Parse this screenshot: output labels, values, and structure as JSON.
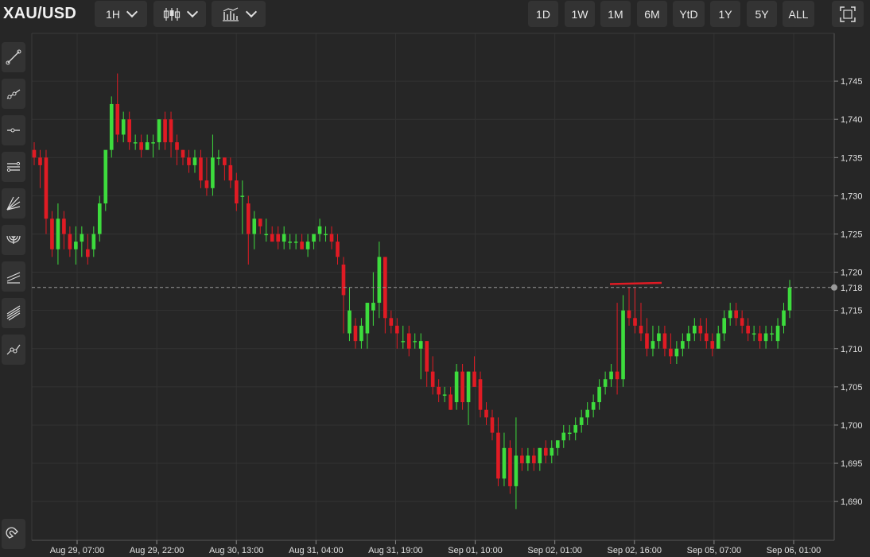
{
  "header": {
    "symbol": "XAU/USD",
    "interval": "1H",
    "chart_style_icon": "candlestick-icon",
    "indicators_icon": "indicators-icon",
    "ranges": [
      "1D",
      "1W",
      "1M",
      "6M",
      "YtD",
      "1Y",
      "5Y",
      "ALL"
    ],
    "fullscreen_icon": "fullscreen-icon"
  },
  "sidebar": {
    "tools": [
      "trend-line-icon",
      "ray-icon",
      "horizontal-ray-icon",
      "parallel-channel-icon",
      "fan-icon",
      "arc-icon",
      "regression-icon",
      "pitchfork-icon",
      "polyline-icon"
    ],
    "magnet_icon": "magnet-icon"
  },
  "colors": {
    "background": "#262626",
    "up": "#3ddc3d",
    "down": "#e01b24",
    "grid": "#333333",
    "button": "#333333"
  },
  "chart_data": {
    "type": "candlestick",
    "title": "",
    "ylim": [
      1687,
      1750
    ],
    "y_ticks": [
      "1,690",
      "1,695",
      "1,700",
      "1,705",
      "1,710",
      "1,715",
      "1,718",
      "1,720",
      "1,725",
      "1,730",
      "1,735",
      "1,740",
      "1,745"
    ],
    "last_price": "1,718",
    "x_ticks": [
      "Aug 29, 07:00",
      "Aug 29, 22:00",
      "Aug 30, 13:00",
      "Aug 31, 04:00",
      "Aug 31, 19:00",
      "Sep 01, 10:00",
      "Sep 02, 01:00",
      "Sep 02, 16:00",
      "Sep 05, 07:00",
      "Sep 06, 01:00"
    ],
    "grid": true,
    "annotations": [
      {
        "type": "horizontal-line",
        "price": 1718.5,
        "color": "#e01b24"
      }
    ],
    "ohlc": [
      [
        1736,
        1737,
        1734,
        1735
      ],
      [
        1735,
        1736,
        1731,
        1734
      ],
      [
        1735,
        1736,
        1725,
        1727
      ],
      [
        1727,
        1728,
        1722,
        1723
      ],
      [
        1723,
        1729,
        1721,
        1727
      ],
      [
        1727,
        1728,
        1723,
        1725
      ],
      [
        1725,
        1726,
        1722,
        1723
      ],
      [
        1723,
        1726,
        1721,
        1724
      ],
      [
        1724,
        1726,
        1722,
        1725
      ],
      [
        1723,
        1725,
        1721,
        1722
      ],
      [
        1723,
        1726,
        1722,
        1725
      ],
      [
        1725,
        1730,
        1724,
        1729
      ],
      [
        1729,
        1734,
        1728,
        1736
      ],
      [
        1736,
        1743,
        1735,
        1742
      ],
      [
        1742,
        1746,
        1737,
        1738
      ],
      [
        1738,
        1741,
        1737,
        1740
      ],
      [
        1740,
        1741,
        1736,
        1737
      ],
      [
        1737,
        1738,
        1736,
        1737
      ],
      [
        1737,
        1738,
        1735,
        1736
      ],
      [
        1736,
        1738,
        1736,
        1737
      ],
      [
        1737,
        1738,
        1735,
        1737
      ],
      [
        1737,
        1740,
        1736,
        1740
      ],
      [
        1740,
        1741,
        1736,
        1737
      ],
      [
        1740,
        1741,
        1735,
        1737
      ],
      [
        1737,
        1738,
        1734,
        1736
      ],
      [
        1736,
        1736,
        1734,
        1735
      ],
      [
        1735,
        1736,
        1733,
        1734
      ],
      [
        1734,
        1736,
        1733,
        1735
      ],
      [
        1735,
        1736,
        1731,
        1732
      ],
      [
        1732,
        1735,
        1730,
        1731
      ],
      [
        1731,
        1738,
        1730,
        1735
      ],
      [
        1735,
        1736,
        1734,
        1735
      ],
      [
        1735,
        1735,
        1732,
        1734
      ],
      [
        1734,
        1735,
        1731,
        1732
      ],
      [
        1732,
        1733,
        1728,
        1729
      ],
      [
        1730,
        1732,
        1725,
        1730
      ],
      [
        1729,
        1730,
        1721,
        1725
      ],
      [
        1725,
        1728,
        1723,
        1727
      ],
      [
        1727,
        1727,
        1725,
        1726
      ],
      [
        1725,
        1727,
        1724,
        1725
      ],
      [
        1725,
        1726,
        1724,
        1724
      ],
      [
        1725,
        1726,
        1723,
        1724
      ],
      [
        1724,
        1726,
        1723,
        1725
      ],
      [
        1724,
        1725,
        1723,
        1724
      ],
      [
        1724,
        1725,
        1723,
        1724
      ],
      [
        1724,
        1725,
        1723,
        1723
      ],
      [
        1723,
        1725,
        1722,
        1724
      ],
      [
        1724,
        1725,
        1723,
        1725
      ],
      [
        1725,
        1727,
        1724,
        1726
      ],
      [
        1725,
        1726,
        1724,
        1725
      ],
      [
        1725,
        1726,
        1723,
        1724
      ],
      [
        1724,
        1725,
        1721,
        1722
      ],
      [
        1721,
        1722,
        1712,
        1717
      ],
      [
        1712,
        1718,
        1711,
        1715
      ],
      [
        1713,
        1714,
        1710,
        1711
      ],
      [
        1711,
        1714,
        1710,
        1713
      ],
      [
        1712,
        1716,
        1710,
        1716
      ],
      [
        1715,
        1720,
        1713,
        1716
      ],
      [
        1716,
        1724,
        1714,
        1722
      ],
      [
        1722,
        1720,
        1712,
        1714
      ],
      [
        1714,
        1715,
        1712,
        1713
      ],
      [
        1713,
        1714,
        1710,
        1712
      ],
      [
        1711,
        1713,
        1710,
        1711
      ],
      [
        1712,
        1713,
        1709,
        1710
      ],
      [
        1711,
        1712,
        1710,
        1711
      ],
      [
        1710,
        1712,
        1706,
        1711
      ],
      [
        1711,
        1711,
        1705,
        1707
      ],
      [
        1707,
        1709,
        1704,
        1705
      ],
      [
        1705,
        1706,
        1703,
        1704
      ],
      [
        1704,
        1705,
        1703,
        1704
      ],
      [
        1704,
        1705,
        1702,
        1702
      ],
      [
        1703,
        1708,
        1702,
        1707
      ],
      [
        1707,
        1708,
        1702,
        1703
      ],
      [
        1703,
        1707,
        1700,
        1707
      ],
      [
        1707,
        1709,
        1705,
        1705
      ],
      [
        1706,
        1707,
        1701,
        1702
      ],
      [
        1702,
        1703,
        1700,
        1701
      ],
      [
        1701,
        1702,
        1698,
        1699
      ],
      [
        1699,
        1701,
        1692,
        1693
      ],
      [
        1693,
        1699,
        1692,
        1697
      ],
      [
        1697,
        1698,
        1691,
        1692
      ],
      [
        1692,
        1701,
        1689,
        1696
      ],
      [
        1696,
        1697,
        1694,
        1695
      ],
      [
        1695,
        1697,
        1694,
        1696
      ],
      [
        1696,
        1697,
        1694,
        1695
      ],
      [
        1695,
        1697,
        1694,
        1697
      ],
      [
        1697,
        1698,
        1695,
        1696
      ],
      [
        1696,
        1698,
        1695,
        1697
      ],
      [
        1697,
        1698,
        1696,
        1698
      ],
      [
        1698,
        1700,
        1697,
        1699
      ],
      [
        1699,
        1700,
        1698,
        1699
      ],
      [
        1699,
        1701,
        1698,
        1700
      ],
      [
        1700,
        1702,
        1699,
        1701
      ],
      [
        1701,
        1703,
        1700,
        1702
      ],
      [
        1702,
        1704,
        1701,
        1703
      ],
      [
        1703,
        1706,
        1702,
        1705
      ],
      [
        1705,
        1707,
        1704,
        1706
      ],
      [
        1706,
        1708,
        1705,
        1707
      ],
      [
        1707,
        1716,
        1704,
        1706
      ],
      [
        1706,
        1717,
        1705,
        1715
      ],
      [
        1715,
        1718,
        1713,
        1714
      ],
      [
        1714,
        1718,
        1712,
        1713
      ],
      [
        1713,
        1716,
        1711,
        1712
      ],
      [
        1712,
        1714,
        1709,
        1710
      ],
      [
        1710,
        1713,
        1709,
        1711
      ],
      [
        1711,
        1713,
        1710,
        1712
      ],
      [
        1712,
        1713,
        1709,
        1710
      ],
      [
        1710,
        1712,
        1708,
        1709
      ],
      [
        1709,
        1711,
        1708,
        1710
      ],
      [
        1710,
        1712,
        1709,
        1711
      ],
      [
        1711,
        1713,
        1710,
        1712
      ],
      [
        1712,
        1714,
        1711,
        1713
      ],
      [
        1713,
        1714,
        1711,
        1712
      ],
      [
        1712,
        1714,
        1710,
        1711
      ],
      [
        1711,
        1712,
        1709,
        1710
      ],
      [
        1710,
        1713,
        1710,
        1712
      ],
      [
        1712,
        1715,
        1711,
        1714
      ],
      [
        1714,
        1716,
        1713,
        1715
      ],
      [
        1715,
        1716,
        1713,
        1714
      ],
      [
        1714,
        1715,
        1712,
        1713
      ],
      [
        1713,
        1714,
        1711,
        1712
      ],
      [
        1712,
        1713,
        1711,
        1712
      ],
      [
        1712,
        1713,
        1710,
        1711
      ],
      [
        1711,
        1713,
        1710,
        1712
      ],
      [
        1712,
        1713,
        1711,
        1712
      ],
      [
        1711,
        1714,
        1710,
        1713
      ],
      [
        1713,
        1716,
        1712,
        1715
      ],
      [
        1715,
        1719,
        1714,
        1718
      ]
    ]
  }
}
